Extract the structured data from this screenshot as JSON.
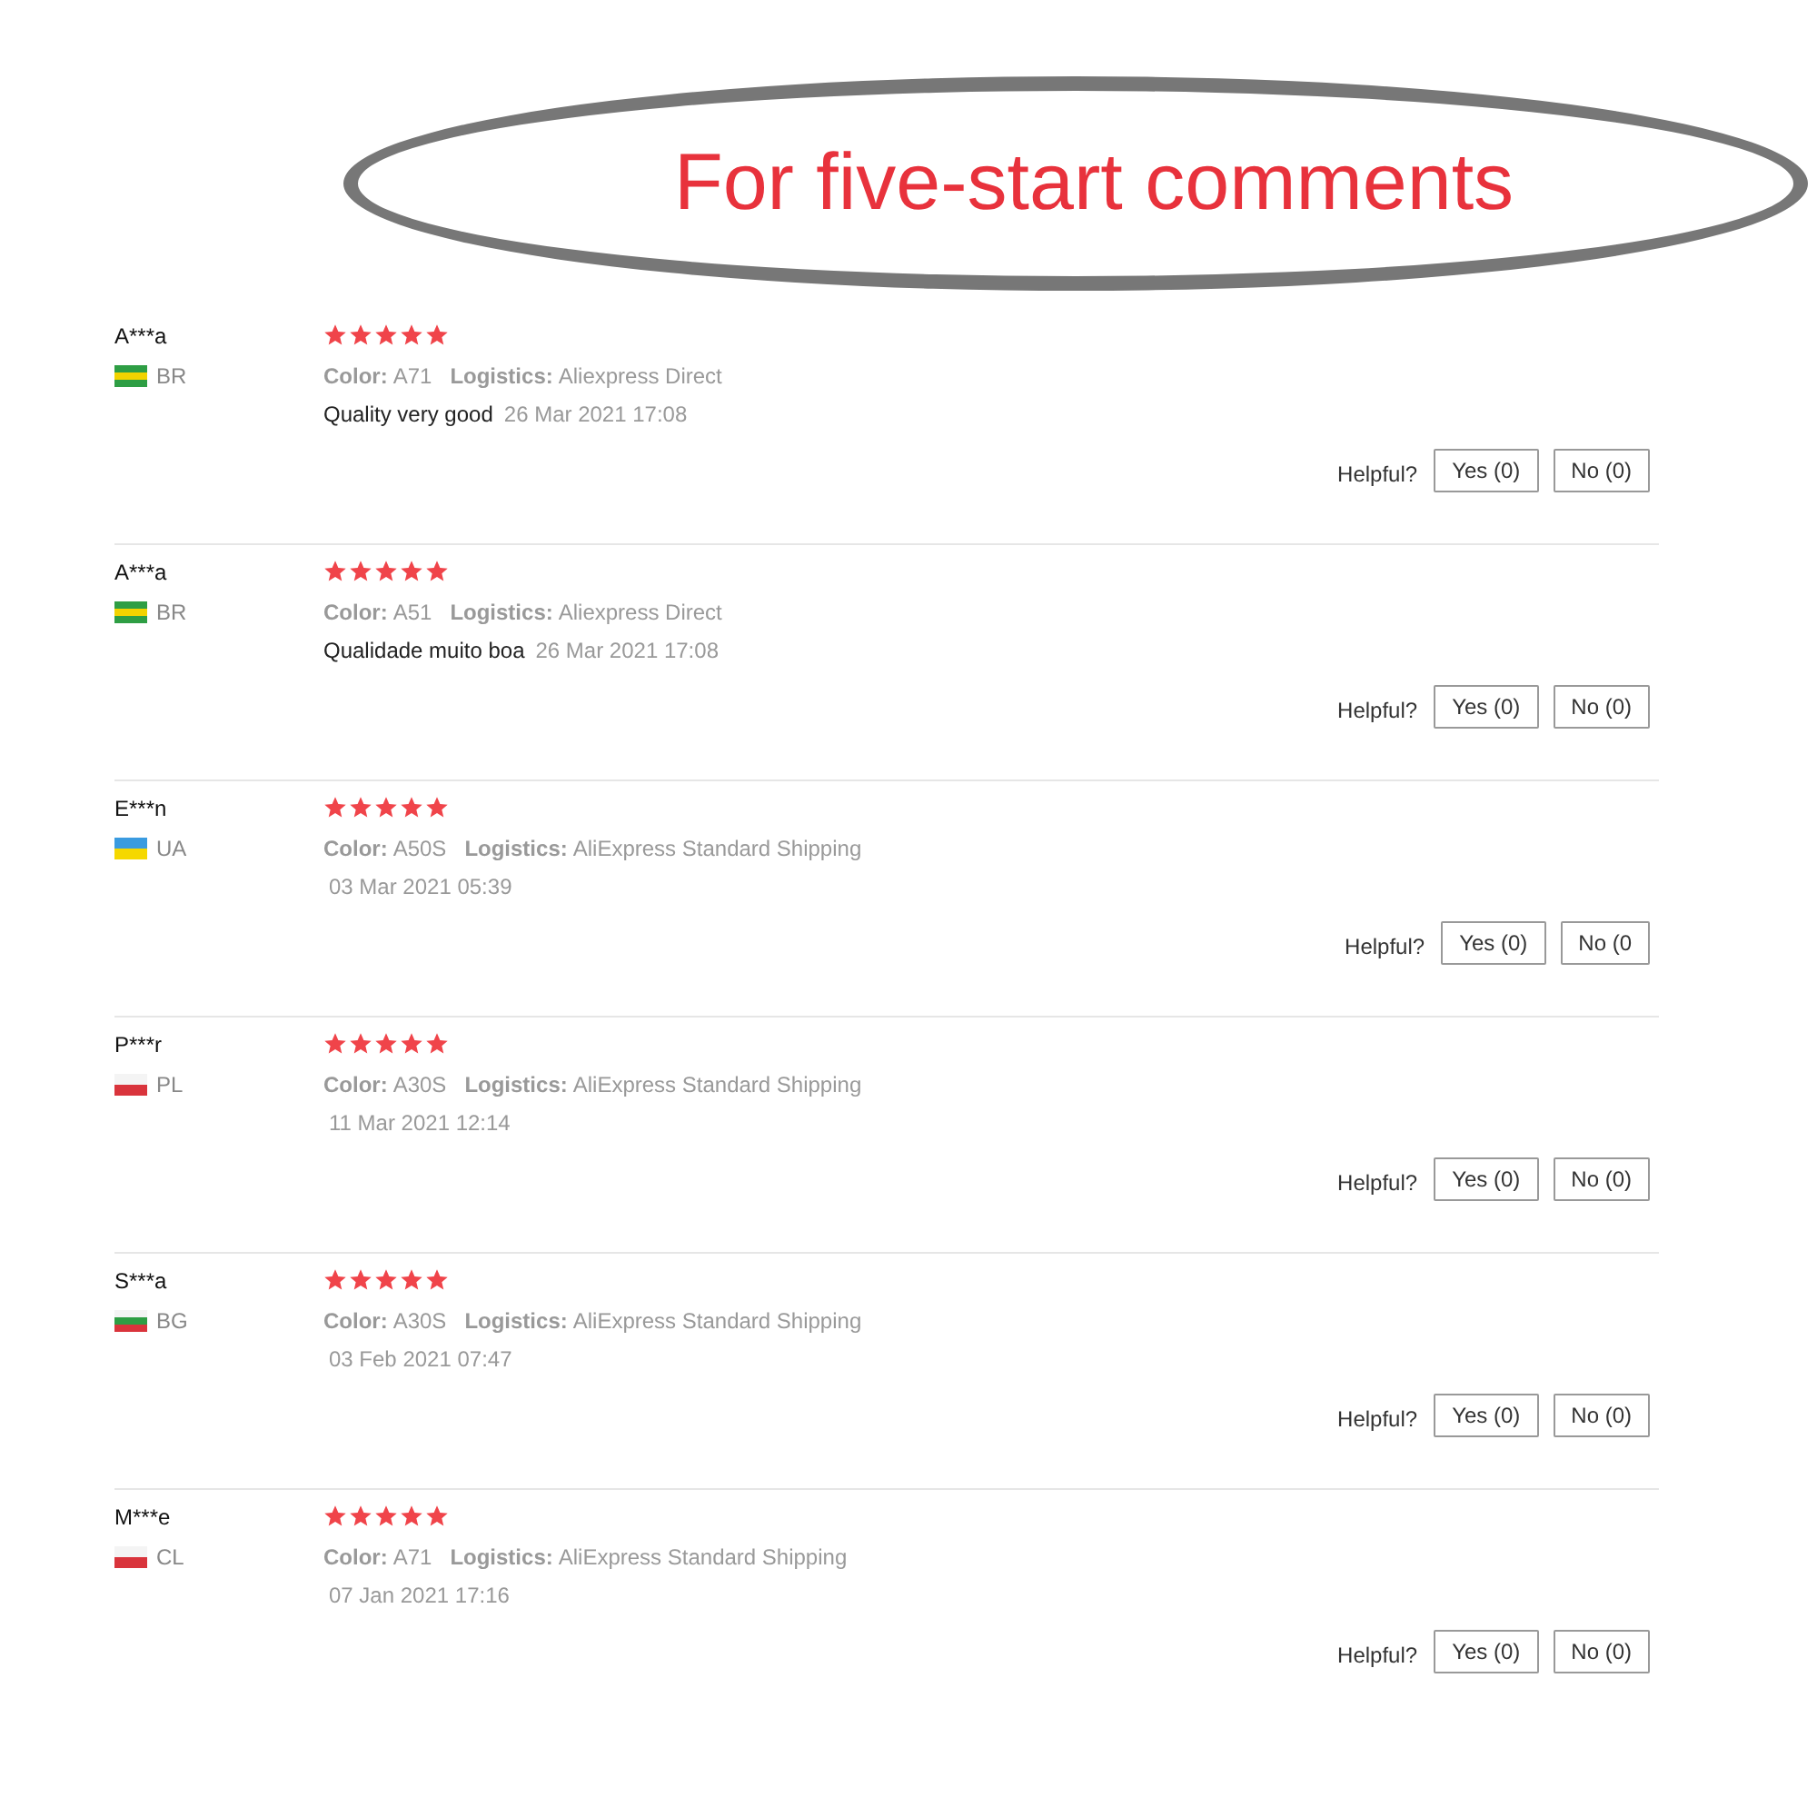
{
  "annotation": {
    "text": "For five-start comments"
  },
  "reviews": [
    {
      "name": "A***a",
      "country": "BR",
      "kind": "greenyellow",
      "stars": 5,
      "color_label": "Color:",
      "color_value": "A71",
      "logistics_label": "Logistics:",
      "logistics": "Aliexpress Direct",
      "comment": "Quality very good",
      "date": "26 Mar 2021 17:08",
      "helpful": "Helpful?",
      "yes": "Yes (0)",
      "no": "No (0)"
    },
    {
      "name": "A***a",
      "country": "BR",
      "kind": "greenyellow",
      "stars": 5,
      "color_label": "Color:",
      "color_value": "A51",
      "logistics_label": "Logistics:",
      "logistics": "Aliexpress Direct",
      "comment": "Qualidade muito boa",
      "date": "26 Mar 2021 17:08",
      "helpful": "Helpful?",
      "yes": "Yes (0)",
      "no": "No (0)"
    },
    {
      "name": "E***n",
      "country": "UA",
      "kind": "blueyellow",
      "stars": 5,
      "color_label": "Color:",
      "color_value": "A50S",
      "logistics_label": "Logistics:",
      "logistics": "AliExpress Standard Shipping",
      "date": "03 Mar 2021 05:39",
      "helpful": "Helpful?",
      "yes": "Yes (0)",
      "no": "No (0"
    },
    {
      "name": "P***r",
      "country": "PL",
      "kind": "whitered",
      "stars": 5,
      "color_label": "Color:",
      "color_value": "A30S",
      "logistics_label": "Logistics:",
      "logistics": "AliExpress Standard Shipping",
      "date": "11 Mar 2021 12:14",
      "helpful": "Helpful?",
      "yes": "Yes (0)",
      "no": "No (0)"
    },
    {
      "name": "S***a",
      "country": "BG",
      "kind": "tricolor",
      "stars": 5,
      "color_label": "Color:",
      "color_value": "A30S",
      "logistics_label": "Logistics:",
      "logistics": "AliExpress Standard Shipping",
      "date": "03 Feb 2021 07:47",
      "helpful": "Helpful?",
      "yes": "Yes (0)",
      "no": "No (0)"
    },
    {
      "name": "M***e",
      "country": "CL",
      "kind": "whitered",
      "stars": 5,
      "color_label": "Color:",
      "color_value": "A71",
      "logistics_label": "Logistics:",
      "logistics": "AliExpress Standard Shipping",
      "date": "07 Jan 2021 17:16",
      "helpful": "Helpful?",
      "yes": "Yes (0)",
      "no": "No (0)"
    }
  ]
}
